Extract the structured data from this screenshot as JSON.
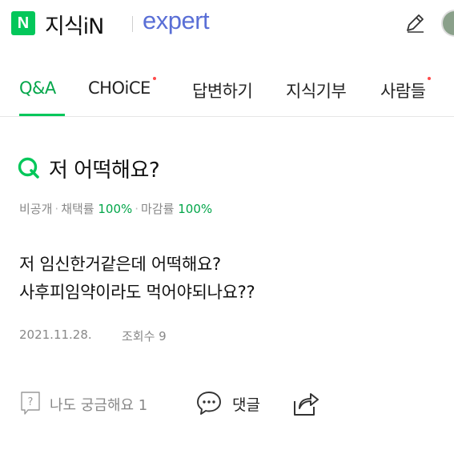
{
  "header": {
    "logo_letter": "N",
    "service_name": "지식iN",
    "sub_brand": "expert",
    "brand_color": "#03c75a",
    "expert_color": "#5a6fd6",
    "write_icon": "pencil-icon",
    "profile_icon": "avatar"
  },
  "tabs": [
    {
      "label": "Q&A",
      "active": true,
      "new_dot": false
    },
    {
      "label": "CHOiCE",
      "active": false,
      "new_dot": true
    },
    {
      "label": "답변하기",
      "active": false,
      "new_dot": false
    },
    {
      "label": "지식기부",
      "active": false,
      "new_dot": false
    },
    {
      "label": "사람들",
      "active": false,
      "new_dot": true
    }
  ],
  "question": {
    "title": "저 어떡해요?",
    "meta": {
      "visibility": "비공개",
      "adoption_label": "채택률",
      "adoption_rate": "100%",
      "close_label": "마감률",
      "close_rate": "100%"
    },
    "body_lines": [
      "저 임신한거같은데 어떡해요?",
      "사후피임약이라도 먹어야되나요??"
    ],
    "date": "2021.11.28.",
    "views": "조회수 9"
  },
  "actions": {
    "curious": "나도 궁금해요 1",
    "comment": "댓글",
    "share_icon": "share-icon"
  },
  "colors": {
    "accent": "#03c75a",
    "accent_text": "#03a64a",
    "muted": "#888888"
  }
}
